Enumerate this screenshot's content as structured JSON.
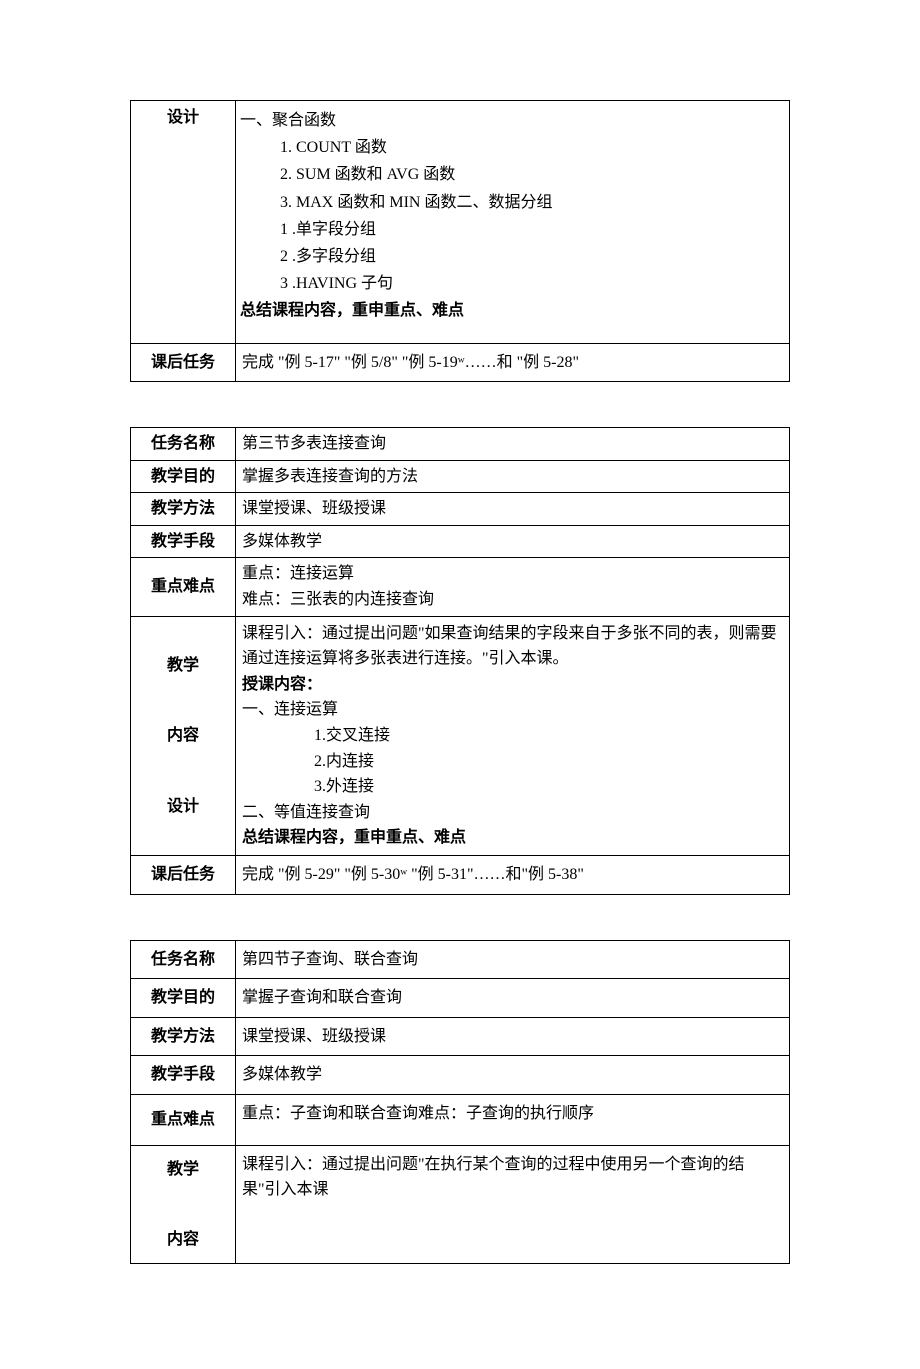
{
  "table1": {
    "row1": {
      "label": "设计",
      "intro": "一、聚合函数",
      "item1": "1.  COUNT 函数",
      "item2": "2.  SUM 函数和 AVG 函数",
      "item3": "3. MAX 函数和 MIN 函数二、数据分组",
      "sub1": "1 .单字段分组",
      "sub2": "2 .多字段分组",
      "sub3": "3 .HAVING 子句",
      "summary": "总结课程内容，重申重点、难点"
    },
    "row2": {
      "label": "课后任务",
      "content": "完成 \"例 5-17\" \"例 5/8\" \"例 5-19ʷ……和 \"例 5-28\""
    }
  },
  "table2": {
    "row1": {
      "label": "任务名称",
      "content": "第三节多表连接查询"
    },
    "row2": {
      "label": "教学目的",
      "content": "掌握多表连接查询的方法"
    },
    "row3": {
      "label": "教学方法",
      "content": "课堂授课、班级授课"
    },
    "row4": {
      "label": "教学手段",
      "content": "多媒体教学"
    },
    "row5": {
      "label": "重点难点",
      "line1": "重点：连接运算",
      "line2": "难点：三张表的内连接查询"
    },
    "row6": {
      "label1": "教学",
      "label2": "内容",
      "label3": "设计",
      "line1": "课程引入：通过提出问题\"如果查询结果的字段来自于多张不同的表，则需要通过连接运算将多张表进行连接。\"引入本课。",
      "line2": "授课内容：",
      "line3": "一、连接运算",
      "sub1": "1.交叉连接",
      "sub2": "2.内连接",
      "sub3": "3.外连接",
      "line4": "二、等值连接查询",
      "summary": "总结课程内容，重申重点、难点"
    },
    "row7": {
      "label": "课后任务",
      "content": "完成 \"例 5-29\" \"例 5-30ʷ \"例 5-31\"……和\"例 5-38\""
    }
  },
  "table3": {
    "row1": {
      "label": "任务名称",
      "content": "第四节子查询、联合查询"
    },
    "row2": {
      "label": "教学目的",
      "content": "掌握子查询和联合查询"
    },
    "row3": {
      "label": "教学方法",
      "content": "课堂授课、班级授课"
    },
    "row4": {
      "label": "教学手段",
      "content": "多媒体教学"
    },
    "row5": {
      "label": "重点难点",
      "content": "重点：子查询和联合查询难点：子查询的执行顺序"
    },
    "row6": {
      "label1": "教学",
      "label2": "内容",
      "content": "课程引入：通过提出问题\"在执行某个查询的过程中使用另一个查询的结果\"引入本课"
    }
  }
}
